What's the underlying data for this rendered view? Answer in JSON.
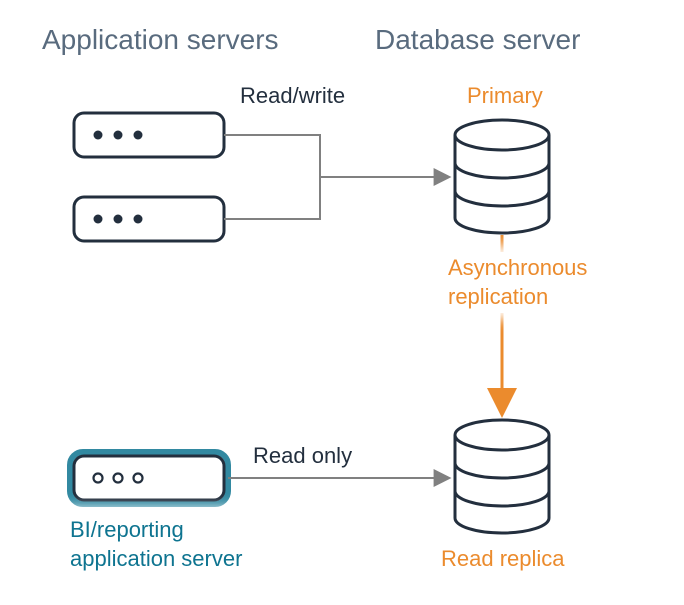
{
  "headers": {
    "appservers": "Application servers",
    "dbserver": "Database server"
  },
  "labels": {
    "readwrite": "Read/write",
    "primary": "Primary",
    "async1": "Asynchronous",
    "async2": "replication",
    "readonly": "Read only",
    "bi1": "BI/reporting",
    "bi2": "application server",
    "readreplica": "Read replica"
  },
  "colors": {
    "orange": "#eb8b2d",
    "teal": "#0e7490",
    "dark": "#232f3e",
    "gray": "#808080"
  }
}
